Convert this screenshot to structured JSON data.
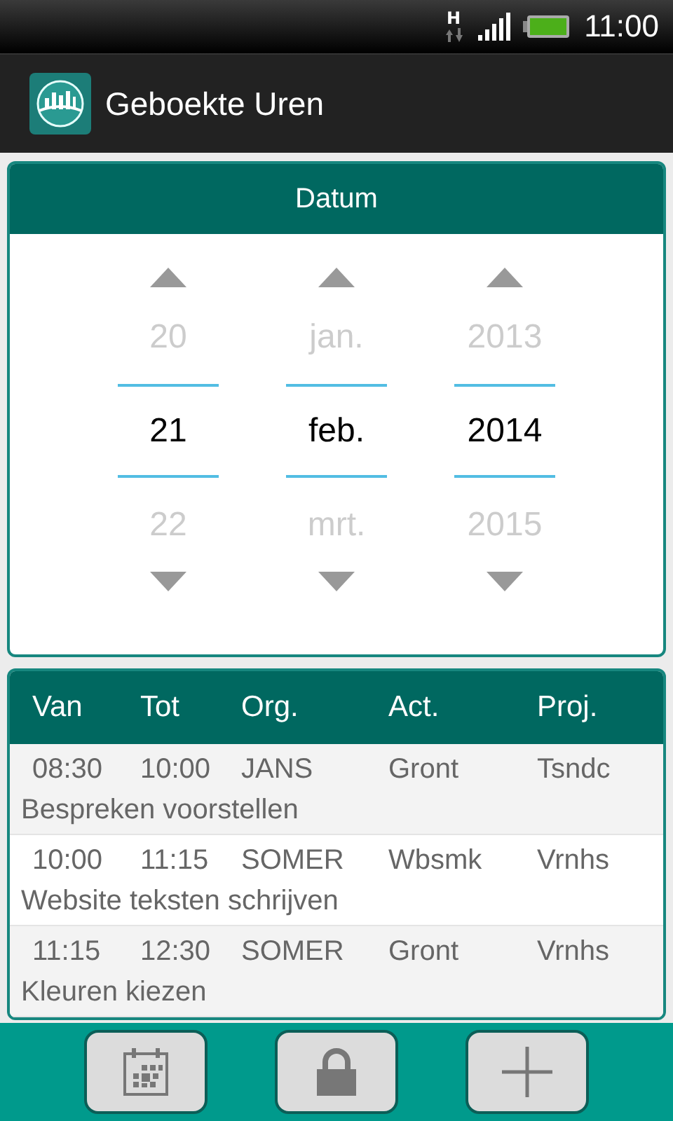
{
  "status_bar": {
    "network": "H",
    "time": "11:00"
  },
  "app_bar": {
    "title": "Geboekte Uren"
  },
  "date_picker": {
    "title": "Datum",
    "columns": [
      {
        "previous": "20",
        "current": "21",
        "next": "22"
      },
      {
        "previous": "jan.",
        "current": "feb.",
        "next": "mrt."
      },
      {
        "previous": "2013",
        "current": "2014",
        "next": "2015"
      }
    ]
  },
  "table": {
    "columns": [
      "Van",
      "Tot",
      "Org.",
      "Act.",
      "Proj."
    ],
    "rows": [
      {
        "cells": [
          "08:30",
          "10:00",
          "JANS",
          "Gront",
          "Tsndc"
        ],
        "description": "Bespreken voorstellen"
      },
      {
        "cells": [
          "10:00",
          "11:15",
          "SOMER",
          "Wbsmk",
          "Vrnhs"
        ],
        "description": "Website teksten schrijven"
      },
      {
        "cells": [
          "11:15",
          "12:30",
          "SOMER",
          "Gront",
          "Vrnhs"
        ],
        "description": "Kleuren kiezen"
      }
    ]
  }
}
